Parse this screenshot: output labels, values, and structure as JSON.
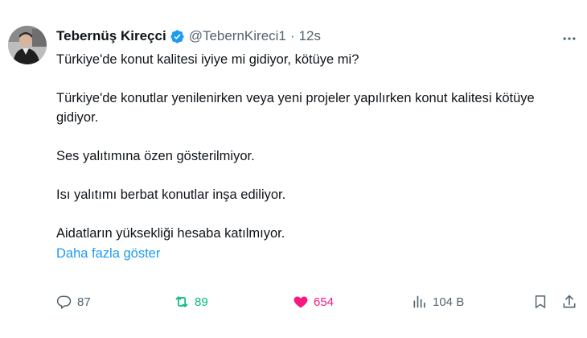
{
  "author": {
    "name": "Tebernüş Kireçci",
    "handle": "@TebernKireci1",
    "separator": "·",
    "time": "12s"
  },
  "tweet": {
    "paragraphs": [
      "Türkiye'de konut kalitesi iyiye mi gidiyor, kötüye mi?",
      "Türkiye'de konutlar yenilenirken veya yeni projeler yapılırken konut kalitesi kötüye gidiyor.",
      "Ses yalıtımına özen gösterilmiyor.",
      "Isı yalıtımı berbat konutlar inşa ediliyor.",
      "Aidatların yüksekliği hesaba katılmıyor."
    ],
    "show_more": "Daha fazla göster"
  },
  "actions": {
    "replies": "87",
    "retweets": "89",
    "likes": "654",
    "views": "104 B"
  },
  "icons": {
    "verified": "verified-badge-icon",
    "more": "more-dots-icon",
    "reply": "reply-icon",
    "retweet": "retweet-icon",
    "like": "heart-icon",
    "views": "views-icon",
    "bookmark": "bookmark-icon",
    "share": "share-icon"
  },
  "colors": {
    "text": "#0f1419",
    "secondary": "#536471",
    "link": "#1d9bf0",
    "retweet_active": "#00ba7c",
    "like_active": "#f91880",
    "verified": "#1d9bf0"
  }
}
